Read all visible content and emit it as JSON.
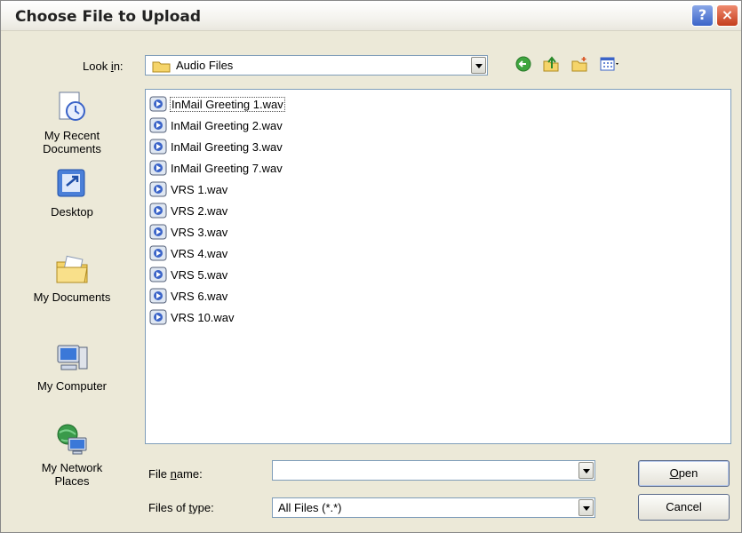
{
  "window": {
    "title": "Choose File to Upload"
  },
  "titlebar": {
    "help_label": "?",
    "close_label": "×"
  },
  "toolbar": {
    "look_in_label_pre": "Look ",
    "look_in_label_key": "i",
    "look_in_label_post": "n:",
    "look_in_value": "Audio Files",
    "icons": [
      "back-icon",
      "up-folder-icon",
      "new-folder-icon",
      "view-menu-icon"
    ]
  },
  "places": [
    {
      "line1": "My Recent",
      "line2": "Documents",
      "icon": "recent-documents-icon"
    },
    {
      "line1": "Desktop",
      "line2": "",
      "icon": "desktop-icon"
    },
    {
      "line1": "My Documents",
      "line2": "",
      "icon": "my-documents-icon"
    },
    {
      "line1": "My Computer",
      "line2": "",
      "icon": "my-computer-icon"
    },
    {
      "line1": "My Network",
      "line2": "Places",
      "icon": "my-network-places-icon"
    }
  ],
  "files": [
    {
      "name": "InMail Greeting 1.wav"
    },
    {
      "name": "InMail Greeting 2.wav"
    },
    {
      "name": "InMail Greeting 3.wav"
    },
    {
      "name": "InMail Greeting 7.wav"
    },
    {
      "name": "VRS 1.wav"
    },
    {
      "name": "VRS 2.wav"
    },
    {
      "name": "VRS 3.wav"
    },
    {
      "name": "VRS 4.wav"
    },
    {
      "name": "VRS 5.wav"
    },
    {
      "name": "VRS 6.wav"
    },
    {
      "name": "VRS 10.wav"
    }
  ],
  "form": {
    "file_name_label_pre": "File ",
    "file_name_label_key": "n",
    "file_name_label_post": "ame:",
    "file_name_value": "",
    "file_type_label_pre": "Files of ",
    "file_type_label_key": "t",
    "file_type_label_post": "ype:",
    "file_type_value": "All Files (*.*)"
  },
  "buttons": {
    "open_key": "O",
    "open_rest": "pen",
    "cancel_label": "Cancel"
  },
  "colors": {
    "dialog_bg": "#ece9d8",
    "field_border": "#7f9db9",
    "folder_yellow": "#f5d46a"
  }
}
